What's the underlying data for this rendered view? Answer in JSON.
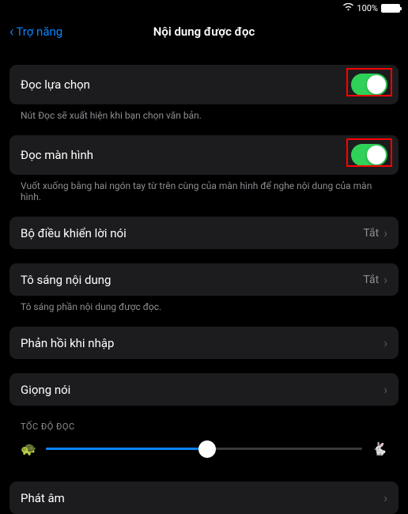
{
  "status": {
    "battery_pct": "100%"
  },
  "nav": {
    "back_label": "Trợ năng",
    "title": "Nội dung được đọc"
  },
  "rows": {
    "speak_selection": {
      "label": "Đọc lựa chọn"
    },
    "speak_selection_footer": "Nút Đọc sẽ xuất hiện khi bạn chọn văn bản.",
    "speak_screen": {
      "label": "Đọc màn hình"
    },
    "speak_screen_footer": "Vuốt xuống bằng hai ngón tay từ trên cùng của màn hình để nghe nội dung của màn hình.",
    "speech_controller": {
      "label": "Bộ điều khiển lời nói",
      "value": "Tắt"
    },
    "highlight_content": {
      "label": "Tô sáng nội dung",
      "value": "Tắt"
    },
    "highlight_content_footer": "Tô sáng phần nội dung được đọc.",
    "typing_feedback": {
      "label": "Phản hồi khi nhập"
    },
    "voices": {
      "label": "Giọng nói"
    },
    "pronunciations": {
      "label": "Phát âm"
    }
  },
  "sections": {
    "speaking_rate": "TỐC ĐỘ ĐỌC"
  },
  "slider": {
    "slow_icon": "🐢",
    "fast_icon": "🐇",
    "value": 0.51
  }
}
